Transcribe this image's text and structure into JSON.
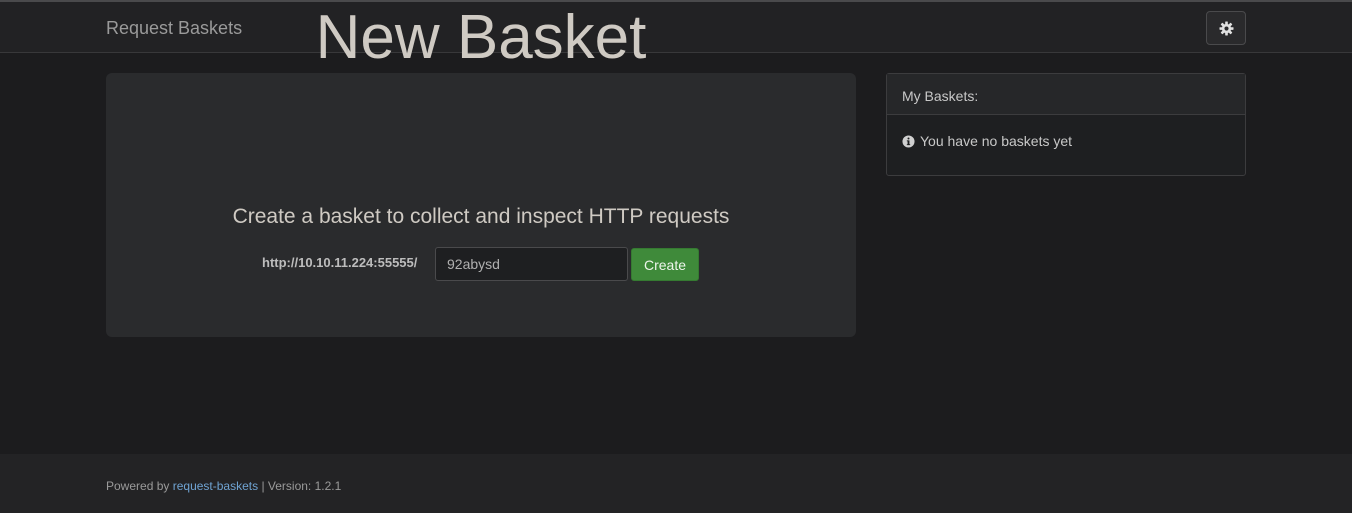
{
  "navbar": {
    "brand": "Request Baskets",
    "settings_icon": "gear-icon"
  },
  "jumbotron": {
    "title": "New Basket",
    "subtitle": "Create a basket to collect and inspect HTTP requests",
    "url_prefix": "http://10.10.11.224:55555/",
    "basket_name_value": "92abysd",
    "create_label": "Create"
  },
  "baskets_panel": {
    "heading": "My Baskets:",
    "empty_icon": "info-circle-icon",
    "empty_message": "You have no baskets yet"
  },
  "footer": {
    "powered_by": "Powered by",
    "link_text": "request-baskets",
    "version_text": "| Version: 1.2.1"
  },
  "colors": {
    "background": "#1c1c1e",
    "create_button": "#3f8a3a",
    "link": "#6fa3d2"
  }
}
